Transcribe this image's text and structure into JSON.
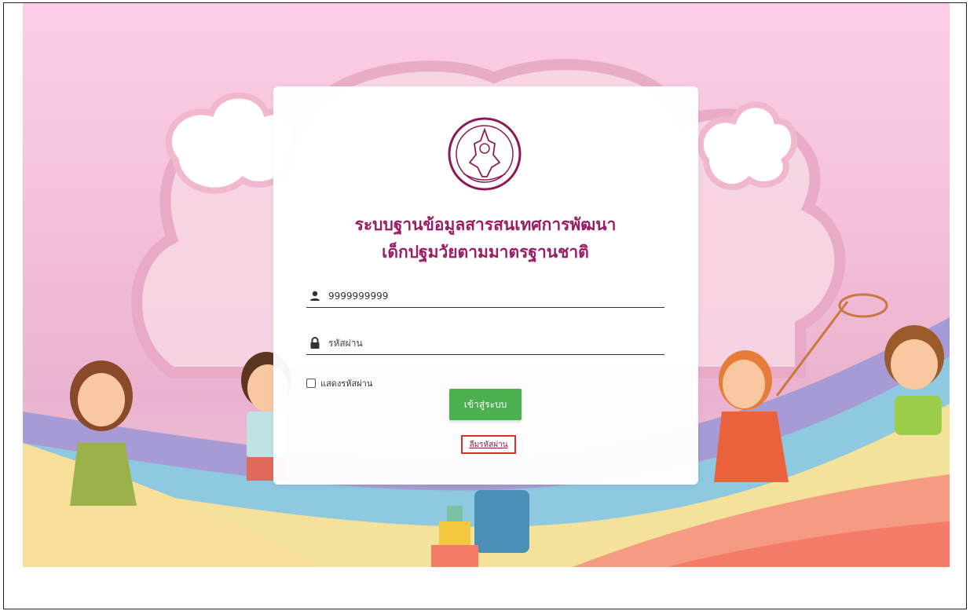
{
  "app": {
    "title_line1": "ระบบฐานข้อมูลสารสนเทศการพัฒนา",
    "title_line2": "เด็กปฐมวัยตามมาตรฐานชาติ"
  },
  "login": {
    "username_value": "9999999999",
    "password_placeholder": "รหัสผ่าน",
    "show_password_label": "แสดงรหัสผ่าน",
    "show_password_checked": false,
    "submit_label": "เข้าสู่ระบบ",
    "forgot_label": "ลืมรหัสผ่าน"
  },
  "icons": {
    "seal": "government-seal-icon",
    "user": "user-icon",
    "lock": "lock-icon"
  },
  "colors": {
    "title": "#9b1c66",
    "submit": "#4caf50",
    "highlight_border": "#d32f2f",
    "background_pink": "#fccde6"
  }
}
